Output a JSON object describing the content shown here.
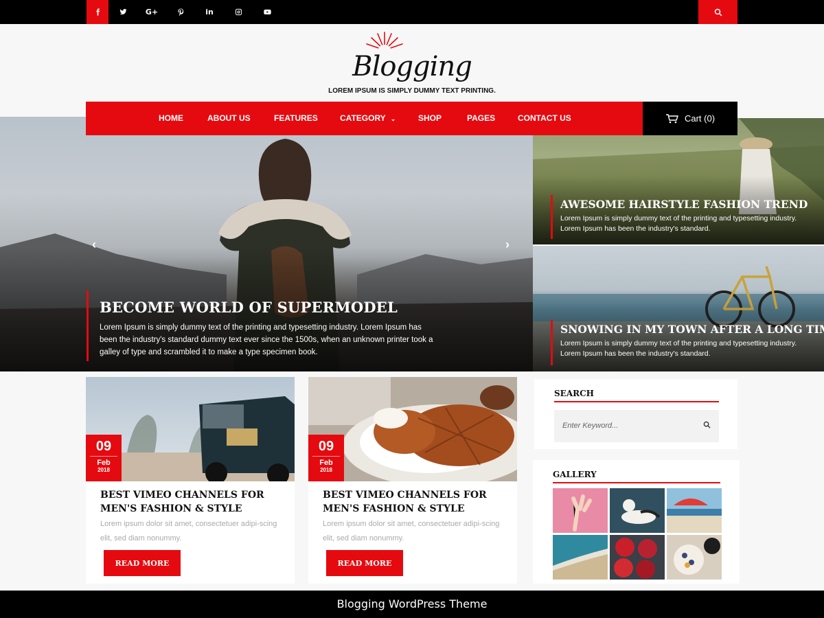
{
  "social": {
    "icons": [
      "facebook-icon",
      "twitter-icon",
      "google-plus-icon",
      "pinterest-icon",
      "linkedin-icon",
      "instagram-icon",
      "youtube-icon"
    ]
  },
  "brand": {
    "logo": "Blogging",
    "tagline": "LOREM IPSUM IS SIMPLY DUMMY TEXT PRINTING."
  },
  "nav": {
    "items": [
      "HOME",
      "ABOUT US",
      "FEATURES",
      "CATEGORY",
      "SHOP",
      "PAGES",
      "CONTACT US"
    ],
    "cart_label": "Cart (0)"
  },
  "hero": {
    "title": "BECOME WORLD OF SUPERMODEL",
    "text": "Lorem Ipsum is simply dummy text of the printing and typesetting industry. Lorem Ipsum has been the industry's standard dummy text ever since the 1500s, when an unknown printer took a galley of type and scrambled it to make a type specimen book.",
    "prev": "‹",
    "next": "›"
  },
  "features": [
    {
      "title": "AWESOME HAIRSTYLE FASHION TREND",
      "text": "Lorem Ipsum is simply dummy text of the printing and typesetting industry. Lorem Ipsum has been the industry's standard."
    },
    {
      "title": "SNOWING IN MY TOWN AFTER A LONG TIME",
      "text": "Lorem Ipsum is simply dummy text of the printing and typesetting industry. Lorem Ipsum has been the industry's standard."
    }
  ],
  "posts": [
    {
      "day": "09",
      "month": "Feb",
      "year": "2018",
      "title": "BEST VIMEO CHANNELS FOR MEN'S FASHION & STYLE",
      "excerpt": "Lorem ipsum dolor sit amet, consectetuer adipi-scing elit, sed diam nonummy.",
      "button": "READ MORE"
    },
    {
      "day": "09",
      "month": "Feb",
      "year": "2018",
      "title": "BEST VIMEO CHANNELS FOR MEN'S FASHION & STYLE",
      "excerpt": "Lorem ipsum dolor sit amet, consectetuer adipi-scing elit, sed diam nonummy.",
      "button": "READ MORE"
    }
  ],
  "sidebar": {
    "search_title": "SEARCH",
    "search_placeholder": "Enter Keyword...",
    "gallery_title": "GALLERY"
  },
  "footer": {
    "text": "Blogging WordPress Theme"
  },
  "colors": {
    "accent": "#e50a0f",
    "dark": "#000000"
  }
}
